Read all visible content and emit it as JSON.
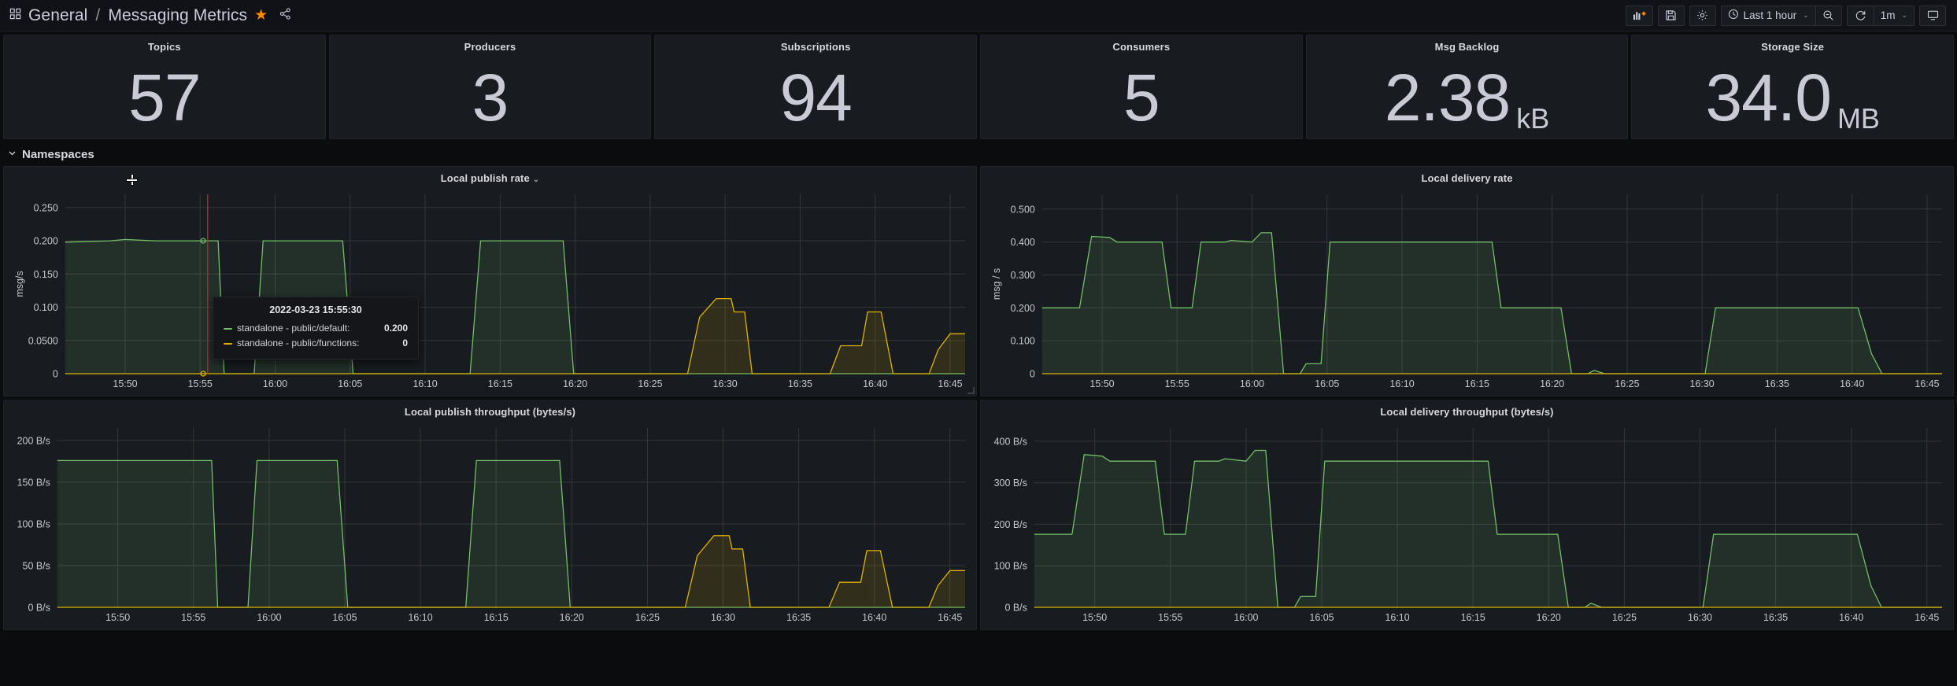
{
  "nav": {
    "grid_icon": "dashboard-grid-icon",
    "folder": "General",
    "separator": "/",
    "dashboard_title": "Messaging Metrics",
    "star_icon": "star-icon",
    "share_icon": "share-icon",
    "add_panel_label": "add-panel-icon",
    "save_label": "save-dashboard-icon",
    "settings_label": "dashboard-settings-icon",
    "time_icon": "clock-icon",
    "time_range": "Last 1 hour",
    "time_chevron": "⌄",
    "zoom_out_label": "zoom-out-icon",
    "refresh_label": "refresh-icon",
    "refresh_interval": "1m",
    "refresh_chevron": "⌄",
    "tv_label": "tv-mode-icon"
  },
  "stats": [
    {
      "title": "Topics",
      "value": "57",
      "unit": ""
    },
    {
      "title": "Producers",
      "value": "3",
      "unit": ""
    },
    {
      "title": "Subscriptions",
      "value": "94",
      "unit": ""
    },
    {
      "title": "Consumers",
      "value": "5",
      "unit": ""
    },
    {
      "title": "Msg Backlog",
      "value": "2.38",
      "unit": "kB"
    },
    {
      "title": "Storage Size",
      "value": "34.0",
      "unit": "MB"
    }
  ],
  "row": {
    "title": "Namespaces",
    "collapse_icon": "chevron-down-icon"
  },
  "colors": {
    "green": "#73bf69",
    "yellow": "#e0b400",
    "accent": "#ff8800",
    "panel_bg": "#181b1f",
    "grid": "#34363a",
    "text": "#d8d9de",
    "crosshair_red": "#b02c2c"
  },
  "tooltip": {
    "time": "2022-03-23 15:55:30",
    "rows": [
      {
        "series": "standalone - public/default:",
        "value": "0.200",
        "color": "#73bf69"
      },
      {
        "series": "standalone - public/functions:",
        "value": "0",
        "color": "#e0b400"
      }
    ]
  },
  "chart_data": [
    {
      "id": "local-publish-rate",
      "type": "area",
      "title": "Local publish rate",
      "has_title_menu": true,
      "ylabel": "msg/s",
      "xlabel": "",
      "grid": true,
      "legend": "hidden",
      "ylim": [
        0,
        0.27
      ],
      "yticks": [
        "0",
        "0.0500",
        "0.100",
        "0.150",
        "0.200",
        "0.250"
      ],
      "ytick_values": [
        0,
        0.05,
        0.1,
        0.15,
        0.2,
        0.25
      ],
      "xticks": [
        "15:50",
        "15:55",
        "16:00",
        "16:05",
        "16:10",
        "16:15",
        "16:20",
        "16:25",
        "16:30",
        "16:35",
        "16:40",
        "16:45"
      ],
      "xlim_minutes": [
        46,
        106
      ],
      "series": [
        {
          "name": "standalone - public/default",
          "color": "#73bf69",
          "points": [
            [
              46,
              0.198
            ],
            [
              49,
              0.2
            ],
            [
              50,
              0.202
            ],
            [
              52,
              0.2
            ],
            [
              55,
              0.2
            ],
            [
              56.2,
              0.2
            ],
            [
              56.6,
              0.0
            ],
            [
              58.6,
              0.0
            ],
            [
              59.2,
              0.2
            ],
            [
              64.5,
              0.2
            ],
            [
              65.2,
              0.0
            ],
            [
              73.0,
              0.0
            ],
            [
              73.7,
              0.2
            ],
            [
              79.2,
              0.2
            ],
            [
              79.9,
              0.0
            ],
            [
              106,
              0.0
            ]
          ]
        },
        {
          "name": "standalone - public/functions",
          "color": "#e0b400",
          "points": [
            [
              46,
              0.0
            ],
            [
              87.5,
              0.0
            ],
            [
              88.3,
              0.085
            ],
            [
              89.4,
              0.113
            ],
            [
              90.4,
              0.113
            ],
            [
              90.6,
              0.093
            ],
            [
              91.3,
              0.093
            ],
            [
              91.8,
              0.0
            ],
            [
              97.0,
              0.0
            ],
            [
              97.7,
              0.042
            ],
            [
              99.1,
              0.042
            ],
            [
              99.5,
              0.093
            ],
            [
              100.4,
              0.093
            ],
            [
              101.2,
              0.0
            ],
            [
              103.6,
              0.0
            ],
            [
              104.2,
              0.036
            ],
            [
              105.0,
              0.06
            ],
            [
              106,
              0.06
            ]
          ]
        }
      ]
    },
    {
      "id": "local-delivery-rate",
      "type": "area",
      "title": "Local delivery rate",
      "has_title_menu": false,
      "ylabel": "msg / s",
      "xlabel": "",
      "grid": true,
      "legend": "hidden",
      "ylim": [
        0,
        0.545
      ],
      "yticks": [
        "0",
        "0.100",
        "0.200",
        "0.300",
        "0.400",
        "0.500"
      ],
      "ytick_values": [
        0,
        0.1,
        0.2,
        0.3,
        0.4,
        0.5
      ],
      "xticks": [
        "15:50",
        "15:55",
        "16:00",
        "16:05",
        "16:10",
        "16:15",
        "16:20",
        "16:25",
        "16:30",
        "16:35",
        "16:40",
        "16:45"
      ],
      "xlim_minutes": [
        46,
        106
      ],
      "series": [
        {
          "name": "standalone - public/default",
          "color": "#73bf69",
          "points": [
            [
              46,
              0.2
            ],
            [
              48.5,
              0.2
            ],
            [
              49.3,
              0.417
            ],
            [
              50.5,
              0.414
            ],
            [
              51.0,
              0.4
            ],
            [
              54.0,
              0.4
            ],
            [
              54.6,
              0.2
            ],
            [
              56.0,
              0.2
            ],
            [
              56.6,
              0.4
            ],
            [
              58.2,
              0.4
            ],
            [
              58.6,
              0.405
            ],
            [
              60.0,
              0.4
            ],
            [
              60.6,
              0.428
            ],
            [
              61.3,
              0.428
            ],
            [
              62.1,
              0.0
            ],
            [
              63.2,
              0.0
            ],
            [
              63.6,
              0.03
            ],
            [
              64.6,
              0.03
            ],
            [
              65.2,
              0.4
            ],
            [
              76.0,
              0.4
            ],
            [
              76.6,
              0.2
            ],
            [
              80.6,
              0.2
            ],
            [
              81.3,
              0.0
            ],
            [
              82.4,
              0.0
            ],
            [
              82.8,
              0.01
            ],
            [
              83.5,
              0.0
            ],
            [
              90.2,
              0.0
            ],
            [
              90.9,
              0.2
            ],
            [
              100.4,
              0.2
            ],
            [
              101.3,
              0.06
            ],
            [
              102.0,
              0.0
            ],
            [
              106,
              0.0
            ]
          ]
        },
        {
          "name": "standalone - public/functions",
          "color": "#e0b400",
          "points": [
            [
              46,
              0.0
            ],
            [
              106,
              0.0
            ]
          ]
        }
      ]
    },
    {
      "id": "local-publish-throughput",
      "type": "area",
      "title": "Local publish throughput (bytes/s)",
      "has_title_menu": false,
      "ylabel": "",
      "xlabel": "",
      "grid": true,
      "legend": "hidden",
      "ylim": [
        0,
        215
      ],
      "yticks": [
        "0 B/s",
        "50 B/s",
        "100 B/s",
        "150 B/s",
        "200 B/s"
      ],
      "ytick_values": [
        0,
        50,
        100,
        150,
        200
      ],
      "xticks": [
        "15:50",
        "15:55",
        "16:00",
        "16:05",
        "16:10",
        "16:15",
        "16:20",
        "16:25",
        "16:30",
        "16:35",
        "16:40",
        "16:45"
      ],
      "xlim_minutes": [
        46,
        106
      ],
      "series": [
        {
          "name": "standalone - public/default",
          "color": "#73bf69",
          "points": [
            [
              46,
              176
            ],
            [
              52,
              176
            ],
            [
              55,
              176
            ],
            [
              56.2,
              176
            ],
            [
              56.6,
              0
            ],
            [
              58.6,
              0
            ],
            [
              59.2,
              176
            ],
            [
              64.5,
              176
            ],
            [
              65.2,
              0
            ],
            [
              73.0,
              0
            ],
            [
              73.7,
              176
            ],
            [
              79.2,
              176
            ],
            [
              79.9,
              0
            ],
            [
              106,
              0
            ]
          ]
        },
        {
          "name": "standalone - public/functions",
          "color": "#e0b400",
          "points": [
            [
              46,
              0
            ],
            [
              87.5,
              0
            ],
            [
              88.3,
              62
            ],
            [
              89.4,
              86
            ],
            [
              90.4,
              86
            ],
            [
              90.6,
              70
            ],
            [
              91.3,
              70
            ],
            [
              91.8,
              0
            ],
            [
              97.0,
              0
            ],
            [
              97.7,
              30
            ],
            [
              99.1,
              30
            ],
            [
              99.5,
              68
            ],
            [
              100.4,
              68
            ],
            [
              101.2,
              0
            ],
            [
              103.6,
              0
            ],
            [
              104.2,
              26
            ],
            [
              105.0,
              44
            ],
            [
              106,
              44
            ]
          ]
        }
      ]
    },
    {
      "id": "local-delivery-throughput",
      "type": "area",
      "title": "Local delivery throughput (bytes/s)",
      "has_title_menu": false,
      "ylabel": "",
      "xlabel": "",
      "grid": true,
      "legend": "hidden",
      "ylim": [
        0,
        432
      ],
      "yticks": [
        "0 B/s",
        "100 B/s",
        "200 B/s",
        "300 B/s",
        "400 B/s"
      ],
      "ytick_values": [
        0,
        100,
        200,
        300,
        400
      ],
      "xticks": [
        "15:50",
        "15:55",
        "16:00",
        "16:05",
        "16:10",
        "16:15",
        "16:20",
        "16:25",
        "16:30",
        "16:35",
        "16:40",
        "16:45"
      ],
      "xlim_minutes": [
        46,
        106
      ],
      "series": [
        {
          "name": "standalone - public/default",
          "color": "#73bf69",
          "points": [
            [
              46,
              176
            ],
            [
              48.5,
              176
            ],
            [
              49.3,
              368
            ],
            [
              50.5,
              364
            ],
            [
              51.0,
              352
            ],
            [
              54.0,
              352
            ],
            [
              54.6,
              176
            ],
            [
              56.0,
              176
            ],
            [
              56.6,
              352
            ],
            [
              58.2,
              352
            ],
            [
              58.6,
              358
            ],
            [
              60.0,
              352
            ],
            [
              60.6,
              378
            ],
            [
              61.3,
              378
            ],
            [
              62.1,
              0
            ],
            [
              63.2,
              0
            ],
            [
              63.6,
              26
            ],
            [
              64.6,
              26
            ],
            [
              65.2,
              352
            ],
            [
              76.0,
              352
            ],
            [
              76.6,
              176
            ],
            [
              80.6,
              176
            ],
            [
              81.3,
              0
            ],
            [
              82.4,
              0
            ],
            [
              82.8,
              10
            ],
            [
              83.5,
              0
            ],
            [
              90.2,
              0
            ],
            [
              90.9,
              176
            ],
            [
              100.4,
              176
            ],
            [
              101.3,
              52
            ],
            [
              102.0,
              0
            ],
            [
              106,
              0
            ]
          ]
        },
        {
          "name": "standalone - public/functions",
          "color": "#e0b400",
          "points": [
            [
              46,
              0
            ],
            [
              106,
              0
            ]
          ]
        }
      ]
    }
  ]
}
